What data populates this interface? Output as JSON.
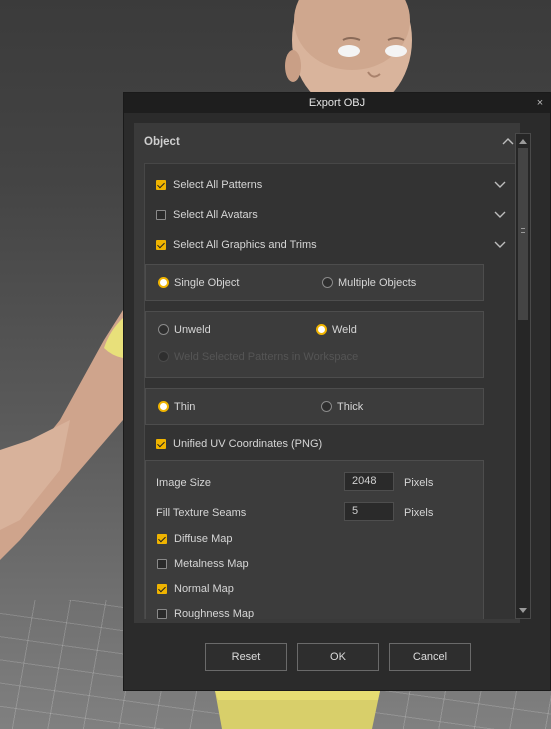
{
  "dialog": {
    "title": "Export OBJ",
    "close_label": "×"
  },
  "panel": {
    "title": "Object"
  },
  "selection": [
    {
      "label": "Select All Patterns",
      "checked": true
    },
    {
      "label": "Select All Avatars",
      "checked": false
    },
    {
      "label": "Select All Graphics and Trims",
      "checked": true
    }
  ],
  "object_mode": {
    "options": [
      "Single Object",
      "Multiple Objects"
    ],
    "selected": "Single Object"
  },
  "weld_mode": {
    "options": [
      "Unweld",
      "Weld"
    ],
    "selected": "Weld",
    "disabled_option": "Weld Selected Patterns in Workspace"
  },
  "thickness": {
    "options": [
      "Thin",
      "Thick"
    ],
    "selected": "Thin"
  },
  "uv": {
    "label": "Unified UV Coordinates (PNG)",
    "checked": true,
    "image_size_label": "Image Size",
    "image_size_value": "2048",
    "image_size_unit": "Pixels",
    "fill_label": "Fill Texture Seams",
    "fill_value": "5",
    "fill_unit": "Pixels",
    "maps": [
      {
        "label": "Diffuse Map",
        "checked": true
      },
      {
        "label": "Metalness Map",
        "checked": false
      },
      {
        "label": "Normal Map",
        "checked": true
      },
      {
        "label": "Roughness Map",
        "checked": false
      }
    ]
  },
  "buttons": {
    "reset": "Reset",
    "ok": "OK",
    "cancel": "Cancel"
  },
  "colors": {
    "accent": "#f0b400",
    "dialog_bg": "#2b2b2b",
    "title_bar": "#1e1e1e"
  }
}
